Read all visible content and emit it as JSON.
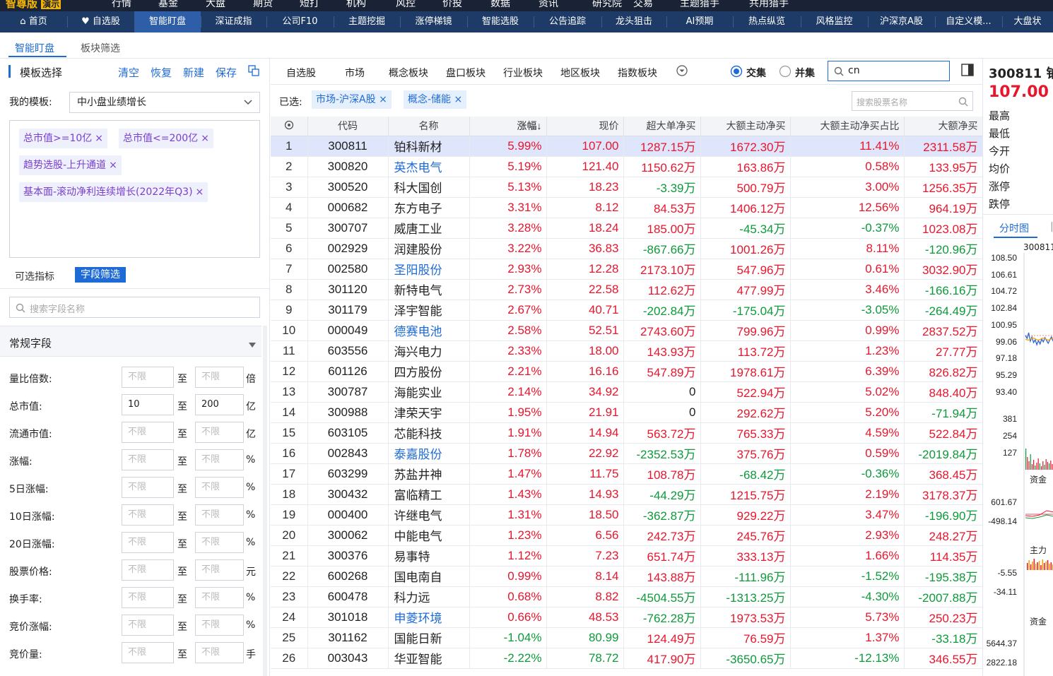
{
  "topbar": {
    "logo": "智尊版",
    "badge": "演示",
    "items": [
      "行情",
      "基金",
      "大盘",
      "期货",
      "短打",
      "机构",
      "风控",
      "价投",
      "数据",
      "资讯",
      "研究院",
      "交易",
      "主题猎手",
      "共用猎手"
    ]
  },
  "navbar": {
    "items": [
      "首页",
      "自选股",
      "智能盯盘",
      "深证成指",
      "公司F10",
      "主题挖掘",
      "涨停梯镜",
      "智能选股",
      "公告追踪",
      "龙头狙击",
      "AI预期",
      "热点纵览",
      "风格监控",
      "沪深京A股",
      "自定义模...",
      "大盘状"
    ],
    "active_index": 2
  },
  "subtabs": {
    "items": [
      "智能盯盘",
      "板块筛选"
    ],
    "active_index": 0
  },
  "left": {
    "header": "模板选择",
    "actions": [
      "清空",
      "恢复",
      "新建",
      "保存"
    ],
    "template_label": "我的模板:",
    "template_value": "中小盘业绩增长",
    "conditions": [
      "总市值>=10亿",
      "总市值<=200亿",
      "趋势选股-上升通道",
      "基本面-滚动净利连续增长(2022年Q3)"
    ],
    "tabs": [
      "可选指标",
      "字段筛选"
    ],
    "search_placeholder": "搜索字段名称",
    "section_title": "常规字段",
    "placeholder": "不限",
    "to": "至",
    "fields": [
      {
        "label": "量比倍数:",
        "min": "",
        "max": "",
        "unit": "倍"
      },
      {
        "label": "总市值:",
        "min": "10",
        "max": "200",
        "unit": "亿"
      },
      {
        "label": "流通市值:",
        "min": "",
        "max": "",
        "unit": "亿"
      },
      {
        "label": "涨幅:",
        "min": "",
        "max": "",
        "unit": "%"
      },
      {
        "label": "5日涨幅:",
        "min": "",
        "max": "",
        "unit": "%"
      },
      {
        "label": "10日涨幅:",
        "min": "",
        "max": "",
        "unit": "%"
      },
      {
        "label": "20日涨幅:",
        "min": "",
        "max": "",
        "unit": "%"
      },
      {
        "label": "股票价格:",
        "min": "",
        "max": "",
        "unit": "元"
      },
      {
        "label": "换手率:",
        "min": "",
        "max": "",
        "unit": "%"
      },
      {
        "label": "竞价涨幅:",
        "min": "",
        "max": "",
        "unit": "%"
      },
      {
        "label": "竞价量:",
        "min": "",
        "max": "",
        "unit": "手"
      }
    ]
  },
  "main": {
    "tabs": [
      "自选股",
      "市场",
      "概念板块",
      "盘口板块",
      "行业板块",
      "地区板块",
      "指数板块"
    ],
    "radio_intersect": "交集",
    "radio_union": "并集",
    "search_value": "cn",
    "selected_label": "已选:",
    "selected": [
      "市场-沪深A股",
      "概念-储能"
    ],
    "stock_search_placeholder": "搜索股票名称",
    "columns": [
      "",
      "代码",
      "名称",
      "涨幅↓",
      "现价",
      "超大单净买",
      "大额主动净买",
      "大额主动净买占比",
      "大额净买"
    ],
    "rows": [
      [
        "1",
        "300811",
        "铂科新材",
        "5.99%",
        "107.00",
        "1287.15万",
        "1672.30万",
        "11.41%",
        "2311.58万"
      ],
      [
        "2",
        "300820",
        "英杰电气",
        "5.19%",
        "121.40",
        "1150.62万",
        "163.86万",
        "0.58%",
        "133.95万"
      ],
      [
        "3",
        "300520",
        "科大国创",
        "5.13%",
        "18.23",
        "-3.39万",
        "500.79万",
        "3.00%",
        "1256.35万"
      ],
      [
        "4",
        "000682",
        "东方电子",
        "3.31%",
        "8.12",
        "84.53万",
        "1406.12万",
        "12.56%",
        "964.19万"
      ],
      [
        "5",
        "300707",
        "威唐工业",
        "3.28%",
        "18.24",
        "185.00万",
        "-45.34万",
        "-0.37%",
        "1023.08万"
      ],
      [
        "6",
        "002929",
        "润建股份",
        "3.22%",
        "36.83",
        "-867.66万",
        "1001.26万",
        "8.11%",
        "-120.96万"
      ],
      [
        "7",
        "002580",
        "圣阳股份",
        "2.93%",
        "12.28",
        "2173.10万",
        "547.96万",
        "0.61%",
        "3032.90万"
      ],
      [
        "8",
        "301120",
        "新特电气",
        "2.73%",
        "22.58",
        "112.62万",
        "477.99万",
        "3.46%",
        "-166.16万"
      ],
      [
        "9",
        "301179",
        "泽宇智能",
        "2.67%",
        "40.71",
        "-202.84万",
        "-175.04万",
        "-3.05%",
        "-264.49万"
      ],
      [
        "10",
        "000049",
        "德赛电池",
        "2.58%",
        "52.51",
        "2743.60万",
        "799.96万",
        "0.99%",
        "2837.52万"
      ],
      [
        "11",
        "603556",
        "海兴电力",
        "2.33%",
        "18.00",
        "143.93万",
        "113.72万",
        "1.23%",
        "27.77万"
      ],
      [
        "12",
        "601126",
        "四方股份",
        "2.21%",
        "16.16",
        "547.89万",
        "1978.61万",
        "6.39%",
        "826.82万"
      ],
      [
        "13",
        "300787",
        "海能实业",
        "2.14%",
        "34.92",
        "0",
        "522.94万",
        "5.02%",
        "848.40万"
      ],
      [
        "14",
        "300988",
        "津荣天宇",
        "1.95%",
        "21.91",
        "0",
        "292.62万",
        "5.20%",
        "-71.94万"
      ],
      [
        "15",
        "603105",
        "芯能科技",
        "1.91%",
        "14.94",
        "563.72万",
        "765.33万",
        "4.59%",
        "522.84万"
      ],
      [
        "16",
        "002843",
        "泰嘉股份",
        "1.78%",
        "22.92",
        "-2352.53万",
        "375.76万",
        "0.59%",
        "-2019.84万"
      ],
      [
        "17",
        "603299",
        "苏盐井神",
        "1.47%",
        "11.75",
        "108.78万",
        "-68.42万",
        "-0.36%",
        "368.45万"
      ],
      [
        "18",
        "300432",
        "富临精工",
        "1.43%",
        "14.93",
        "-44.29万",
        "1215.75万",
        "2.19%",
        "3178.37万"
      ],
      [
        "19",
        "000400",
        "许继电气",
        "1.31%",
        "18.50",
        "-362.87万",
        "929.22万",
        "3.47%",
        "-196.90万"
      ],
      [
        "20",
        "300062",
        "中能电气",
        "1.23%",
        "6.56",
        "242.73万",
        "245.76万",
        "2.93%",
        "248.27万"
      ],
      [
        "21",
        "300376",
        "易事特",
        "1.12%",
        "7.23",
        "651.74万",
        "333.13万",
        "1.66%",
        "114.35万"
      ],
      [
        "22",
        "600268",
        "国电南自",
        "0.99%",
        "8.14",
        "143.88万",
        "-111.96万",
        "-1.52%",
        "-195.38万"
      ],
      [
        "23",
        "600478",
        "科力远",
        "0.68%",
        "8.82",
        "-4504.55万",
        "-1313.25万",
        "-4.30%",
        "-2007.88万"
      ],
      [
        "24",
        "301018",
        "申菱环境",
        "0.66%",
        "48.53",
        "-762.28万",
        "1973.53万",
        "5.73%",
        "250.23万"
      ],
      [
        "25",
        "301162",
        "国能日新",
        "-1.04%",
        "80.99",
        "124.49万",
        "76.59万",
        "1.37%",
        "-33.18万"
      ],
      [
        "26",
        "003043",
        "华亚智能",
        "-2.22%",
        "78.72",
        "417.90万",
        "-3650.65万",
        "-12.13%",
        "346.55万"
      ]
    ],
    "link_names": [
      "英杰电气",
      "圣阳股份",
      "德赛电池",
      "泰嘉股份",
      "申菱环境"
    ]
  },
  "right": {
    "code": "300811",
    "name_partial": "铂",
    "price": "107.00",
    "labels": [
      "最高",
      "最低",
      "今开",
      "均价",
      "涨停",
      "跌停"
    ],
    "tab": "分时图",
    "chart_code": "300811",
    "price_axis": [
      "108.50",
      "106.61",
      "104.72",
      "102.84",
      "100.95",
      "99.06",
      "97.18",
      "95.29",
      "93.40"
    ],
    "vol_axis": [
      "381",
      "254",
      "127"
    ],
    "fund_label": "资金",
    "fund_axis": [
      "601.67",
      "-498.14"
    ],
    "main_label": "主力",
    "main_axis": [
      "-5.55",
      "-34.11"
    ],
    "fund2_label": "资金",
    "fund2_axis": [
      "5644.37",
      "2822.18"
    ],
    "colors": {
      "up": "#e8162d",
      "down": "#0d9a3a",
      "accent": "#1e6bd6"
    }
  }
}
